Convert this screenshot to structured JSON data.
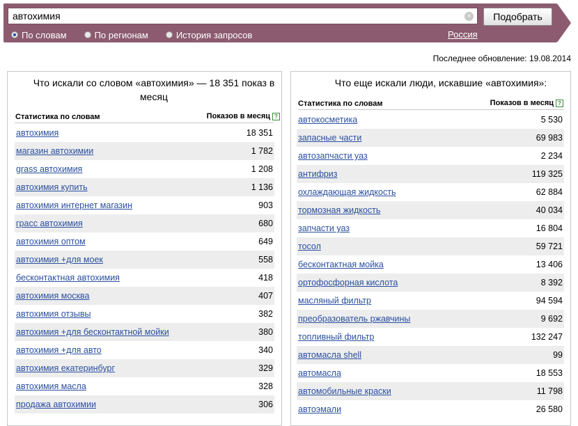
{
  "search": {
    "value": "автохимия",
    "button_label": "Подобрать",
    "clear_symbol": "×"
  },
  "tabs": [
    {
      "label": "По словам",
      "selected": true
    },
    {
      "label": "По регионам",
      "selected": false
    },
    {
      "label": "История запросов",
      "selected": false
    }
  ],
  "region_label": "Россия",
  "updated_text": "Последнее обновление: 19.08.2014",
  "left_panel": {
    "title": "Что искали со словом «автохимия» — 18 351 показ в месяц",
    "col_phrase": "Статистика по словам",
    "col_count": "Показов в месяц",
    "rows": [
      {
        "phrase": "автохимия",
        "count": "18 351"
      },
      {
        "phrase": "магазин автохимии",
        "count": "1 782"
      },
      {
        "phrase": "grass автохимия",
        "count": "1 208"
      },
      {
        "phrase": "автохимия купить",
        "count": "1 136"
      },
      {
        "phrase": "автохимия интернет магазин",
        "count": "903"
      },
      {
        "phrase": "грасс автохимия",
        "count": "680"
      },
      {
        "phrase": "автохимия оптом",
        "count": "649"
      },
      {
        "phrase": "автохимия +для моек",
        "count": "558"
      },
      {
        "phrase": "бесконтактная автохимия",
        "count": "418"
      },
      {
        "phrase": "автохимия москва",
        "count": "407"
      },
      {
        "phrase": "автохимия отзывы",
        "count": "382"
      },
      {
        "phrase": "автохимия +для бесконтактной мойки",
        "count": "380"
      },
      {
        "phrase": "автохимия +для авто",
        "count": "340"
      },
      {
        "phrase": "автохимия екатеринбург",
        "count": "329"
      },
      {
        "phrase": "автохимия масла",
        "count": "328"
      },
      {
        "phrase": "продажа автохимии",
        "count": "306"
      }
    ]
  },
  "right_panel": {
    "title": "Что еще искали люди, искавшие «автохимия»:",
    "col_phrase": "Статистика по словам",
    "col_count": "Показов в месяц",
    "rows": [
      {
        "phrase": "автокосметика",
        "count": "5 530"
      },
      {
        "phrase": "запасные части",
        "count": "69 983"
      },
      {
        "phrase": "автозапчасти уаз",
        "count": "2 234"
      },
      {
        "phrase": "антифриз",
        "count": "119 325"
      },
      {
        "phrase": "охлаждающая жидкость",
        "count": "62 884"
      },
      {
        "phrase": "тормозная жидкость",
        "count": "40 034"
      },
      {
        "phrase": "запчасти уаз",
        "count": "16 804"
      },
      {
        "phrase": "тосол",
        "count": "59 721"
      },
      {
        "phrase": "бесконтактная мойка",
        "count": "13 406"
      },
      {
        "phrase": "ортофосфорная кислота",
        "count": "8 392"
      },
      {
        "phrase": "масляный фильтр",
        "count": "94 594"
      },
      {
        "phrase": "преобразователь ржавчины",
        "count": "9 692"
      },
      {
        "phrase": "топливный фильтр",
        "count": "132 247"
      },
      {
        "phrase": "автомасла shell",
        "count": "99"
      },
      {
        "phrase": "автомасла",
        "count": "18 553"
      },
      {
        "phrase": "автомобильные краски",
        "count": "11 798"
      },
      {
        "phrase": "автоэмали",
        "count": "26 580"
      }
    ]
  },
  "colors": {
    "band": "#8c5b6f",
    "link": "#2a4fa0",
    "row_alt": "#ededed"
  },
  "icons": {
    "help": "help-icon",
    "clear": "clear-icon"
  }
}
